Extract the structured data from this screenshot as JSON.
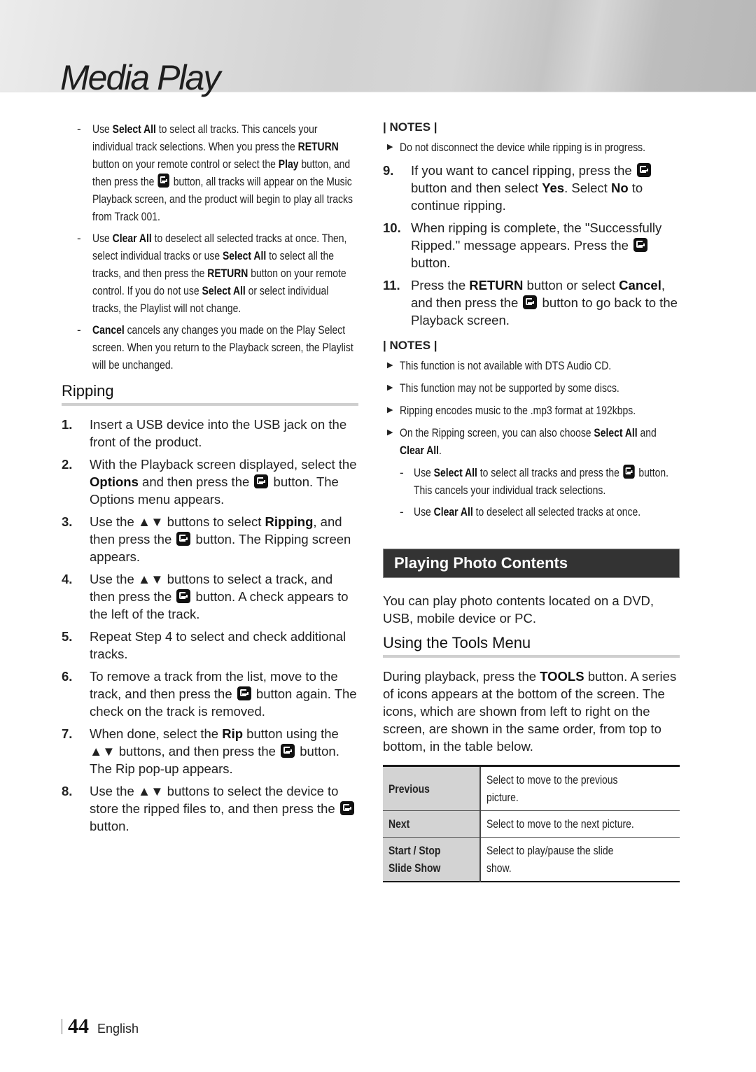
{
  "header": {
    "title": "Media Play"
  },
  "left": {
    "dash_items": [
      {
        "parts": [
          {
            "t": "Use "
          },
          {
            "t": "Select All",
            "b": true
          },
          {
            "t": " to select all tracks. This cancels your individual track selections. When you press the "
          },
          {
            "t": "RETURN",
            "b": true
          },
          {
            "t": " button on your remote control or select the "
          },
          {
            "t": "Play",
            "b": true
          },
          {
            "t": " button, and then press the "
          },
          {
            "icon": "enter"
          },
          {
            "t": " button, all tracks will appear on the Music Playback screen, and the product will begin to play all tracks from Track 001."
          }
        ]
      },
      {
        "parts": [
          {
            "t": "Use "
          },
          {
            "t": "Clear All",
            "b": true
          },
          {
            "t": " to deselect all selected tracks at once. Then, select individual tracks or use "
          },
          {
            "t": "Select All",
            "b": true
          },
          {
            "t": " to select all the tracks, and then press the "
          },
          {
            "t": "RETURN",
            "b": true
          },
          {
            "t": " button on your remote control. If you do not use "
          },
          {
            "t": "Select All",
            "b": true
          },
          {
            "t": " or select individual tracks, the Playlist will not change."
          }
        ]
      },
      {
        "parts": [
          {
            "t": "Cancel",
            "b": true
          },
          {
            "t": " cancels any changes you made on the Play Select screen. When you return to the Playback screen, the Playlist will be unchanged."
          }
        ]
      }
    ],
    "section_title": "Ripping",
    "steps": [
      {
        "num": "1.",
        "parts": [
          {
            "t": "Insert a USB device into the USB jack on the front of the product."
          }
        ]
      },
      {
        "num": "2.",
        "parts": [
          {
            "t": "With the Playback screen displayed, select the "
          },
          {
            "t": "Options",
            "b": true
          },
          {
            "t": " and then press the "
          },
          {
            "icon": "enter"
          },
          {
            "t": " button. The Options menu appears."
          }
        ]
      },
      {
        "num": "3.",
        "parts": [
          {
            "t": "Use the ▲▼ buttons to select "
          },
          {
            "t": "Ripping",
            "b": true
          },
          {
            "t": ", and then press the "
          },
          {
            "icon": "enter"
          },
          {
            "t": " button. The Ripping screen appears."
          }
        ]
      },
      {
        "num": "4.",
        "parts": [
          {
            "t": "Use the ▲▼ buttons to select a track, and then press the "
          },
          {
            "icon": "enter"
          },
          {
            "t": " button. A check appears to the left of the track."
          }
        ]
      },
      {
        "num": "5.",
        "parts": [
          {
            "t": "Repeat Step 4 to select and check additional tracks."
          }
        ]
      },
      {
        "num": "6.",
        "parts": [
          {
            "t": "To remove a track from the list, move to the track, and then press the "
          },
          {
            "icon": "enter"
          },
          {
            "t": " button again. The check on the track is removed."
          }
        ]
      },
      {
        "num": "7.",
        "parts": [
          {
            "t": "When done, select the "
          },
          {
            "t": "Rip",
            "b": true
          },
          {
            "t": " button using the ▲▼ buttons, and then press the "
          },
          {
            "icon": "enter"
          },
          {
            "t": " button. The Rip pop-up appears."
          }
        ]
      },
      {
        "num": "8.",
        "parts": [
          {
            "t": "Use the ▲▼ buttons to select the device to store the ripped files to, and then press the "
          },
          {
            "icon": "enter"
          },
          {
            "t": " button."
          }
        ]
      }
    ]
  },
  "right": {
    "notes_label": "| NOTES |",
    "notes1": [
      {
        "parts": [
          {
            "t": "Do not disconnect the device while ripping is in progress."
          }
        ]
      }
    ],
    "steps": [
      {
        "num": "9.",
        "parts": [
          {
            "t": "If you want to cancel ripping, press the "
          },
          {
            "icon": "enter"
          },
          {
            "t": " button and then select "
          },
          {
            "t": "Yes",
            "b": true
          },
          {
            "t": ". Select "
          },
          {
            "t": "No",
            "b": true
          },
          {
            "t": " to continue ripping."
          }
        ]
      },
      {
        "num": "10.",
        "parts": [
          {
            "t": "When ripping is complete, the \"Successfully Ripped.\" message appears. Press the "
          },
          {
            "icon": "enter"
          },
          {
            "t": " button."
          }
        ]
      },
      {
        "num": "11.",
        "parts": [
          {
            "t": "Press the "
          },
          {
            "t": "RETURN",
            "b": true
          },
          {
            "t": " button or select "
          },
          {
            "t": "Cancel",
            "b": true
          },
          {
            "t": ", and then press the "
          },
          {
            "icon": "enter"
          },
          {
            "t": " button to go back to the Playback screen."
          }
        ]
      }
    ],
    "notes2": [
      {
        "parts": [
          {
            "t": "This function is not available with DTS Audio CD."
          }
        ]
      },
      {
        "parts": [
          {
            "t": "This function may not be supported by some discs."
          }
        ]
      },
      {
        "parts": [
          {
            "t": "Ripping encodes music to the .mp3 format at 192kbps."
          }
        ]
      },
      {
        "parts": [
          {
            "t": "On the Ripping screen, you can also choose "
          },
          {
            "t": "Select All",
            "b": true
          },
          {
            "t": " and "
          },
          {
            "t": "Clear All",
            "b": true
          },
          {
            "t": "."
          }
        ]
      }
    ],
    "subnotes": [
      {
        "parts": [
          {
            "t": "Use "
          },
          {
            "t": "Select All",
            "b": true
          },
          {
            "t": " to select all tracks and press the "
          },
          {
            "icon": "enter"
          },
          {
            "t": " button. This cancels your individual track selections."
          }
        ]
      },
      {
        "parts": [
          {
            "t": "Use "
          },
          {
            "t": "Clear All",
            "b": true
          },
          {
            "t": " to deselect all selected tracks at once."
          }
        ]
      }
    ],
    "banner_title": "Playing Photo Contents",
    "intro": "You can play photo contents located on a DVD, USB, mobile device or PC.",
    "subsection_title": "Using the Tools Menu",
    "tools_intro": [
      {
        "t": "During playback, press the "
      },
      {
        "t": "TOOLS",
        "b": true
      },
      {
        "t": " button. A series of icons appears at the bottom of the screen. The icons, which are shown from left to right on the screen, are shown in the same order, from top to bottom, in the table below."
      }
    ],
    "table": [
      {
        "key": "Previous",
        "value": "Select to move to the previous picture."
      },
      {
        "key": "Next",
        "value": "Select to move to the next picture."
      },
      {
        "key": "Start / Stop\nSlide Show",
        "value": "Select to play/pause the slide show."
      }
    ]
  },
  "footer": {
    "page_number": "44",
    "language": "English"
  },
  "glyphs": {
    "dash": "-",
    "triangle": "▶"
  }
}
